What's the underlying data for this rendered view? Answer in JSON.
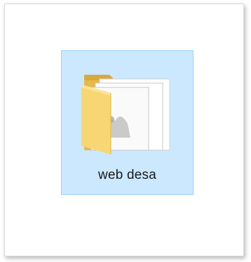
{
  "desktop": {
    "folder": {
      "name": "web desa",
      "icon": "folder-icon",
      "selected": true
    }
  },
  "colors": {
    "selection_fill": "#cce8ff",
    "selection_border": "#99d1ff",
    "folder_yellow": "#f7d674",
    "folder_dark": "#e6b94a",
    "document_blue": "#1e7ad6"
  }
}
